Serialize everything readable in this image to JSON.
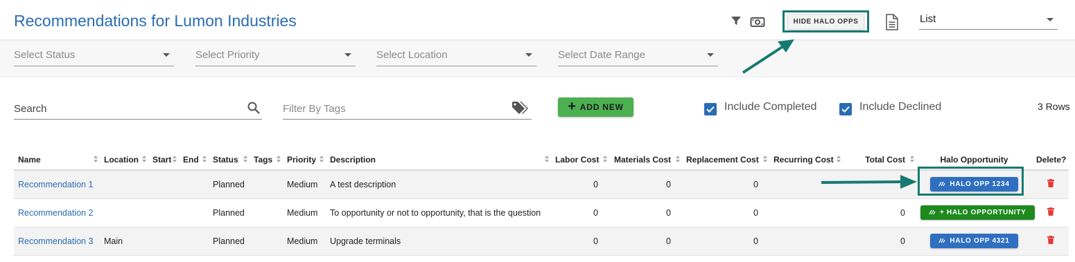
{
  "header": {
    "title": "Recommendations for Lumon Industries",
    "hide_halo_label": "HIDE HALO OPPS",
    "view_value": "List",
    "filter_icon": "filter-icon",
    "money_icon": "money-icon",
    "document_icon": "document-icon"
  },
  "filters": {
    "status_placeholder": "Select Status",
    "priority_placeholder": "Select Priority",
    "location_placeholder": "Select Location",
    "date_placeholder": "Select Date Range"
  },
  "toolbar": {
    "search_placeholder": "Search",
    "tags_placeholder": "Filter By Tags",
    "add_new_label": "ADD NEW",
    "include_completed_label": "Include Completed",
    "include_declined_label": "Include Declined",
    "include_completed_checked": true,
    "include_declined_checked": true,
    "rows_count": "3 Rows"
  },
  "table": {
    "columns": {
      "name": "Name",
      "location": "Location",
      "start": "Start",
      "end": "End",
      "status": "Status",
      "tags": "Tags",
      "priority": "Priority",
      "description": "Description",
      "labor_cost": "Labor Cost",
      "materials_cost": "Materials Cost",
      "replacement_cost": "Replacement Cost",
      "recurring_cost": "Recurring Cost",
      "total_cost": "Total Cost",
      "halo": "Halo Opportunity",
      "delete": "Delete?"
    },
    "rows": [
      {
        "name": "Recommendation 1",
        "location": "",
        "start": "",
        "end": "",
        "status": "Planned",
        "tags": "",
        "priority": "Medium",
        "description": "A test description",
        "labor_cost": "0",
        "materials_cost": "0",
        "replacement_cost": "0",
        "recurring_cost": "",
        "total_cost": "",
        "halo_label": "HALO OPP 1234",
        "halo_color": "#2f6fc0"
      },
      {
        "name": "Recommendation 2",
        "location": "",
        "start": "",
        "end": "",
        "status": "Planned",
        "tags": "",
        "priority": "Medium",
        "description": "To opportunity or not to opportunity, that is the question",
        "labor_cost": "0",
        "materials_cost": "0",
        "replacement_cost": "0",
        "recurring_cost": "",
        "total_cost": "0",
        "halo_label": "+ HALO OPPORTUNITY",
        "halo_color": "#1e8a1e"
      },
      {
        "name": "Recommendation 3",
        "location": "Main",
        "start": "",
        "end": "",
        "status": "Planned",
        "tags": "",
        "priority": "Medium",
        "description": "Upgrade terminals",
        "labor_cost": "0",
        "materials_cost": "0",
        "replacement_cost": "0",
        "recurring_cost": "",
        "total_cost": "0",
        "halo_label": "HALO OPP 4321",
        "halo_color": "#2f6fc0"
      }
    ]
  },
  "colors": {
    "accent": "#2a6cb3",
    "callout": "#177a72",
    "add_button": "#4caf50",
    "delete": "#e53935"
  }
}
